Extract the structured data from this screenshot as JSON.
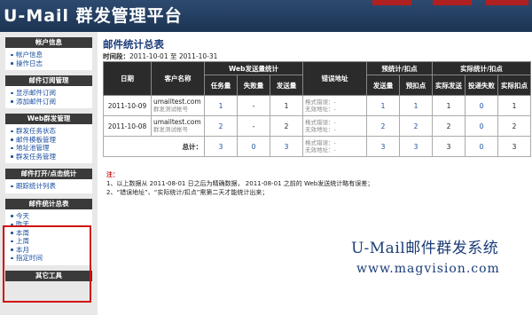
{
  "header": {
    "title": "U-Mail 群发管理平台"
  },
  "sidebar": {
    "sections": [
      {
        "title": "帐户信息",
        "items": [
          "帐户信息",
          "操作日志"
        ]
      },
      {
        "title": "邮件订阅管理",
        "items": [
          "显示邮件订阅",
          "添加邮件订阅"
        ]
      },
      {
        "title": "Web群发管理",
        "items": [
          "群发任务状态",
          "邮件模板管理",
          "地址池管理",
          "群发任务管理"
        ]
      },
      {
        "title": "邮件打开/点击统计",
        "items": [
          "跟踪统计列表"
        ]
      },
      {
        "title": "邮件统计总表",
        "items": [
          "今天",
          "昨天",
          "本周",
          "上周",
          "本月",
          "指定时间"
        ]
      },
      {
        "title": "其它工具",
        "items": []
      }
    ]
  },
  "main": {
    "title": "邮件统计总表",
    "period_label": "时间段：",
    "period_value": "2011-10-01 至 2011-10-31",
    "table": {
      "h_date": "日期",
      "h_customer": "客户名称",
      "h_web_group": "Web发送量统计",
      "h_error": "错误地址",
      "h_pre_group": "预统计/扣点",
      "h_actual_group": "实际统计/扣点",
      "h_task": "任务量",
      "h_fail": "失败量",
      "h_sent": "发送量",
      "h_pre_sent": "发送量",
      "h_pre_deduct": "预扣点",
      "h_act_sent": "实际发送",
      "h_act_invalid": "投递失败",
      "h_act_deduct": "实际扣点",
      "rows": [
        {
          "date": "2011-10-09",
          "customer": "umailtest.com",
          "customer_sub": "群发测试帐号",
          "task": "1",
          "fail": "-",
          "sent": "1",
          "err1": "格式错误：-",
          "err2": "无效地址：-",
          "pre_sent": "1",
          "pre_deduct": "1",
          "act_sent": "1",
          "act_invalid": "0",
          "act_deduct": "1"
        },
        {
          "date": "2011-10-08",
          "customer": "umailtest.com",
          "customer_sub": "群发测试帐号",
          "task": "2",
          "fail": "-",
          "sent": "2",
          "err1": "格式错误：-",
          "err2": "无效地址：-",
          "pre_sent": "2",
          "pre_deduct": "2",
          "act_sent": "2",
          "act_invalid": "0",
          "act_deduct": "2"
        }
      ],
      "total": {
        "label": "总计：",
        "task": "3",
        "fail": "0",
        "sent": "3",
        "err1": "格式错误：-",
        "err2": "无效地址：-",
        "pre_sent": "3",
        "pre_deduct": "3",
        "act_sent": "3",
        "act_invalid": "0",
        "act_deduct": "3"
      }
    },
    "notes": {
      "label": "注：",
      "line1": "1、以上数据从 2011-08-01 日之后为精确数据， 2011-08-01 之前的 Web发送统计略有误差；",
      "line2": "2、“错误地址”、“实际统计/扣点”需第二天才能统计出来；"
    },
    "brand_name": "U-Mail邮件群发系统",
    "brand_url": "www.magvision.com"
  }
}
